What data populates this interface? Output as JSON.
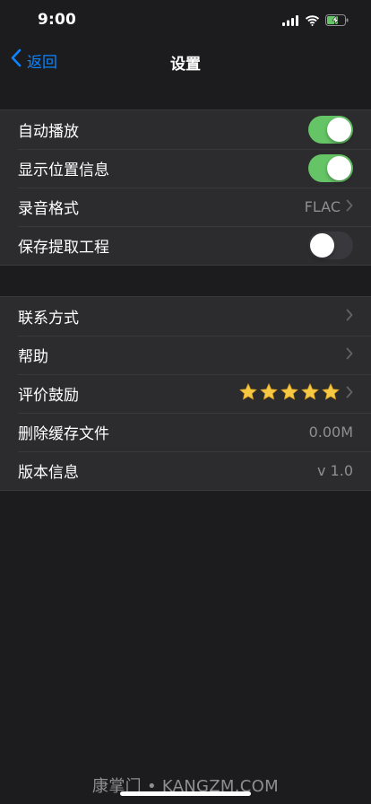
{
  "status_bar": {
    "time": "9:00"
  },
  "nav": {
    "back_label": "返回",
    "title": "设置"
  },
  "group1": [
    {
      "label": "自动播放",
      "control": "toggle",
      "on": true
    },
    {
      "label": "显示位置信息",
      "control": "toggle",
      "on": true
    },
    {
      "label": "录音格式",
      "value": "FLAC",
      "control": "chevron"
    },
    {
      "label": "保存提取工程",
      "control": "toggle",
      "on": false
    }
  ],
  "group2": [
    {
      "label": "联系方式",
      "control": "chevron"
    },
    {
      "label": "帮助",
      "control": "chevron"
    },
    {
      "label": "评价鼓励",
      "control": "stars",
      "rating": 5
    },
    {
      "label": "删除缓存文件",
      "value": "0.00M"
    },
    {
      "label": "版本信息",
      "value": "v 1.0"
    }
  ],
  "watermark": "康掌门 • KANGZM.COM",
  "colors": {
    "accent": "#0a84ff",
    "toggle_on": "#65c466",
    "background": "#1c1c1e",
    "cell": "#2c2c2e",
    "secondary_text": "#8e8e93"
  }
}
